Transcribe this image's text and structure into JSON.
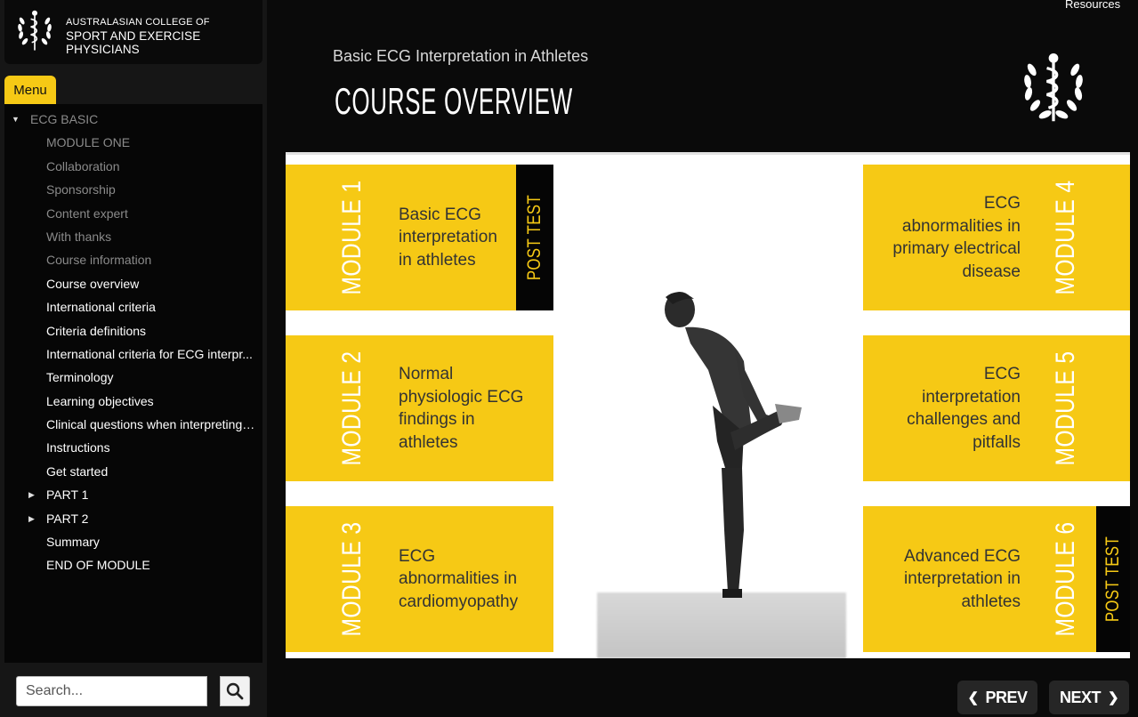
{
  "org": {
    "line1": "AUSTRALASIAN COLLEGE OF",
    "line2": "SPORT AND EXERCISE PHYSICIANS"
  },
  "header": {
    "resources_label": "Resources",
    "course_title": "Basic ECG Interpretation in Athletes",
    "page_title": "COURSE OVERVIEW"
  },
  "menu": {
    "tab_label": "Menu",
    "root": {
      "label": "ECG BASIC",
      "expanded": true
    },
    "items": [
      {
        "label": "MODULE ONE",
        "state": "visited"
      },
      {
        "label": "Collaboration",
        "state": "visited"
      },
      {
        "label": "Sponsorship",
        "state": "visited"
      },
      {
        "label": "Content expert",
        "state": "visited"
      },
      {
        "label": "With thanks",
        "state": "visited"
      },
      {
        "label": "Course information",
        "state": "visited"
      },
      {
        "label": "Course overview",
        "state": "active"
      },
      {
        "label": "International criteria",
        "state": "active"
      },
      {
        "label": "Criteria definitions",
        "state": "active"
      },
      {
        "label": "International criteria for ECG interpr...",
        "state": "active"
      },
      {
        "label": "Terminology",
        "state": "active"
      },
      {
        "label": "Learning objectives",
        "state": "active"
      },
      {
        "label": "Clinical questions when interpreting ...",
        "state": "active"
      },
      {
        "label": "Instructions",
        "state": "active"
      },
      {
        "label": "Get started",
        "state": "active"
      },
      {
        "label": "PART 1",
        "state": "active",
        "collapsed": true
      },
      {
        "label": "PART 2",
        "state": "active",
        "collapsed": true
      },
      {
        "label": "Summary",
        "state": "active"
      },
      {
        "label": "END OF MODULE",
        "state": "active"
      }
    ]
  },
  "search": {
    "placeholder": "Search..."
  },
  "slide": {
    "modules": [
      {
        "label": "MODULE 1",
        "text": [
          "Basic ECG",
          "interpretation",
          "in athletes"
        ]
      },
      {
        "label": "MODULE 2",
        "text": [
          "Normal",
          "physiologic ECG",
          "findings in",
          "athletes"
        ]
      },
      {
        "label": "MODULE 3",
        "text": [
          "ECG",
          "abnormalities in",
          "cardiomyopathy"
        ]
      },
      {
        "label": "MODULE 4",
        "text": [
          "ECG",
          "abnormalities in",
          "primary electrical",
          "disease"
        ]
      },
      {
        "label": "MODULE 5",
        "text": [
          "ECG",
          "interpretation",
          "challenges and",
          "pitfalls"
        ]
      },
      {
        "label": "MODULE 6",
        "text": [
          "Advanced ECG",
          "interpretation in",
          "athletes"
        ]
      }
    ],
    "post_test_label": "POST TEST"
  },
  "nav": {
    "prev_label": "PREV",
    "next_label": "NEXT"
  },
  "colors": {
    "accent": "#f6c915",
    "background": "#0a0a0a",
    "sidebar": "#161616"
  },
  "icons": {
    "emblem": "staff-of-asclepius-laurel-icon",
    "search": "search-icon",
    "caret_down": "caret-down-icon",
    "caret_right": "caret-right-icon",
    "prev": "chevron-left-icon",
    "next": "chevron-right-icon"
  }
}
